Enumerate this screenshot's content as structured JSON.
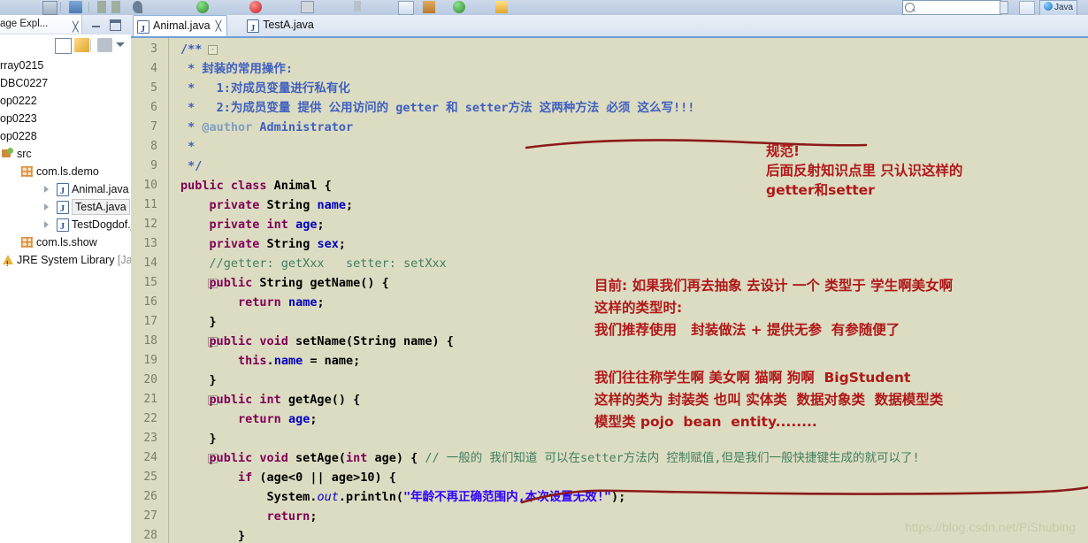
{
  "toolbar": {
    "search_placeholder": "",
    "perspective_label": "Java",
    "icons": [
      "save-icon",
      "print-icon",
      "undo-icon",
      "redo-icon",
      "debug-icon",
      "run-icon",
      "coverage-icon",
      "external-tools-icon",
      "new-icon",
      "search-icon",
      "next-annotation-icon",
      "open-type-icon",
      "java-perspective-icon"
    ]
  },
  "explorer": {
    "title": "age Expl...",
    "close_glyph": "╳",
    "toolbar_icons": [
      "collapse-all-icon",
      "link-with-editor-icon",
      "focus-icon",
      "view-menu-icon"
    ],
    "tree": [
      {
        "label": "rray0215",
        "indent": 0,
        "icon": "none",
        "arrow": false,
        "selected": false,
        "dim": false
      },
      {
        "label": "DBC0227",
        "indent": 0,
        "icon": "none",
        "arrow": false,
        "selected": false,
        "dim": false
      },
      {
        "label": "op0222",
        "indent": 0,
        "icon": "none",
        "arrow": false,
        "selected": false,
        "dim": false
      },
      {
        "label": "op0223",
        "indent": 0,
        "icon": "none",
        "arrow": false,
        "selected": false,
        "dim": false
      },
      {
        "label": "op0228",
        "indent": 0,
        "icon": "none",
        "arrow": false,
        "selected": false,
        "dim": false
      },
      {
        "label": "src",
        "indent": 0,
        "icon": "source-folder-icon",
        "arrow": false,
        "selected": false,
        "dim": false
      },
      {
        "label": "com.ls.demo",
        "indent": 1,
        "icon": "package-icon",
        "arrow": false,
        "selected": false,
        "dim": false
      },
      {
        "label": "Animal.java",
        "indent": 2,
        "icon": "java-file-icon",
        "arrow": true,
        "selected": false,
        "dim": false
      },
      {
        "label": "TestA.java",
        "indent": 2,
        "icon": "java-file-icon",
        "arrow": true,
        "selected": true,
        "dim": false
      },
      {
        "label": "TestDogdof.java",
        "indent": 2,
        "icon": "java-file-icon",
        "arrow": true,
        "selected": false,
        "dim": false
      },
      {
        "label": "com.ls.show",
        "indent": 1,
        "icon": "package-icon",
        "arrow": false,
        "selected": false,
        "dim": false
      },
      {
        "label": "JRE System Library",
        "suffix": "[Ja",
        "indent": 0,
        "icon": "jre-library-icon",
        "arrow": false,
        "selected": false,
        "dim": false
      }
    ]
  },
  "editor": {
    "tabs": [
      {
        "label": "Animal.java",
        "active": true,
        "close_glyph": "╳"
      },
      {
        "label": "TestA.java",
        "active": false,
        "close_glyph": ""
      }
    ],
    "first_visible_line": 3,
    "lines": [
      {
        "n": 3,
        "fold": "-",
        "html": "<span class=\"cmj\">/**</span>"
      },
      {
        "n": 4,
        "fold": "",
        "html": "<span class=\"cmj\"> * 封装的常用操作:</span>"
      },
      {
        "n": 5,
        "fold": "",
        "html": "<span class=\"cmj\"> *   1:对成员变量进行私有化</span>"
      },
      {
        "n": 6,
        "fold": "",
        "html": "<span class=\"cmj\"> *   2:为成员变量 提供 公用访问的 getter 和 setter方法 这两种方法 必须 这么写!!!</span>"
      },
      {
        "n": 7,
        "fold": "",
        "html": "<span class=\"cmj\"> * </span><span class=\"cmtag\">@author</span><span class=\"cmj\"> Administrator</span>"
      },
      {
        "n": 8,
        "fold": "",
        "html": "<span class=\"cmj\"> *</span>"
      },
      {
        "n": 9,
        "fold": "",
        "html": "<span class=\"cmj\"> */</span>"
      },
      {
        "n": 10,
        "fold": "",
        "html": "<span class=\"kw\">public class</span><span class=\"pln\"> Animal {</span>"
      },
      {
        "n": 11,
        "fold": "",
        "html": "<span class=\"pln\">    </span><span class=\"kw\">private</span><span class=\"pln\"> String </span><span class=\"fld\">name</span><span class=\"pln\">;</span>"
      },
      {
        "n": 12,
        "fold": "",
        "html": "<span class=\"pln\">    </span><span class=\"kw\">private int</span><span class=\"pln\"> </span><span class=\"fld\">age</span><span class=\"pln\">;</span>"
      },
      {
        "n": 13,
        "fold": "",
        "html": "<span class=\"pln\">    </span><span class=\"kw\">private</span><span class=\"pln\"> String </span><span class=\"fld\">sex</span><span class=\"pln\">;</span>"
      },
      {
        "n": 14,
        "fold": "",
        "html": "<span class=\"pln\">    </span><span class=\"cm\">//getter: getXxx   setter: setXxx</span>"
      },
      {
        "n": 15,
        "fold": "-",
        "html": "<span class=\"pln\">    </span><span class=\"kw\">public</span><span class=\"pln\"> String getName() {</span>"
      },
      {
        "n": 16,
        "fold": "",
        "html": "<span class=\"pln\">        </span><span class=\"kw\">return</span><span class=\"pln\"> </span><span class=\"fld\">name</span><span class=\"pln\">;</span>"
      },
      {
        "n": 17,
        "fold": "",
        "html": "<span class=\"pln\">    }</span>"
      },
      {
        "n": 18,
        "fold": "-",
        "html": "<span class=\"pln\">    </span><span class=\"kw\">public void</span><span class=\"pln\"> setName(String name) {</span>"
      },
      {
        "n": 19,
        "fold": "",
        "html": "<span class=\"pln\">        </span><span class=\"kw\">this</span><span class=\"pln\">.</span><span class=\"fld\">name</span><span class=\"pln\"> = name;</span>"
      },
      {
        "n": 20,
        "fold": "",
        "html": "<span class=\"pln\">    }</span>"
      },
      {
        "n": 21,
        "fold": "-",
        "html": "<span class=\"pln\">    </span><span class=\"kw\">public int</span><span class=\"pln\"> getAge() {</span>"
      },
      {
        "n": 22,
        "fold": "",
        "html": "<span class=\"pln\">        </span><span class=\"kw\">return</span><span class=\"pln\"> </span><span class=\"fld\">age</span><span class=\"pln\">;</span>"
      },
      {
        "n": 23,
        "fold": "",
        "html": "<span class=\"pln\">    }</span>"
      },
      {
        "n": 24,
        "fold": "-",
        "html": "<span class=\"pln\">    </span><span class=\"kw\">public void</span><span class=\"pln\"> setAge(</span><span class=\"kw\">int</span><span class=\"pln\"> age) { </span><span class=\"cm\">// 一般的 我们知道 可以在setter方法内 控制赋值,但是我们一般快捷键生成的就可以了!</span>"
      },
      {
        "n": 25,
        "fold": "",
        "html": "<span class=\"pln\">        </span><span class=\"kw\">if</span><span class=\"pln\"> (age&lt;0 || age&gt;10) {</span>"
      },
      {
        "n": 26,
        "fold": "",
        "html": "<span class=\"pln\">            System.</span><span class=\"itl\">out</span><span class=\"pln\">.println(</span><span class=\"str\">\"年龄不再正确范围内,本次设置无效!\"</span><span class=\"pln\">);</span>"
      },
      {
        "n": 27,
        "fold": "",
        "html": "<span class=\"pln\">            </span><span class=\"kw\">return</span><span class=\"pln\">;</span>"
      },
      {
        "n": 28,
        "fold": "",
        "html": "<span class=\"pln\">        }</span>"
      }
    ]
  },
  "annotations": [
    {
      "name": "annotation-standard",
      "lines": [
        "规范!",
        "后面反射知识点里 只认识这样的",
        "getter和setter"
      ],
      "color": "#b01818"
    },
    {
      "name": "annotation-abstraction",
      "lines": [
        "目前: 如果我们再去抽象 去设计 一个 类型于 学生啊美女啊",
        "这样的类型时:",
        "我们推荐使用   封装做法 + 提供无参  有参随便了"
      ],
      "color": "#b01818"
    },
    {
      "name": "annotation-pojo",
      "lines": [
        "我们往往称学生啊 美女啊 猫啊 狗啊  BigStudent",
        "这样的类为 封装类 也叫 实体类  数据对象类  数据模型类",
        "模型类 pojo  bean  entity........"
      ],
      "color": "#b01818"
    }
  ],
  "underlines": [
    {
      "name": "underline-getter-setter",
      "color": "#8b1a1a"
    },
    {
      "name": "underline-setage-comment",
      "color": "#8b1a1a"
    }
  ],
  "watermark": "https://blog.csdn.net/PiShubing",
  "colors": {
    "editor_background": "#dcdcc2",
    "annotation_red": "#b01818",
    "underline_red": "#8b1a1a",
    "keyword_purple": "#7f0055",
    "comment_green": "#3f7f5f",
    "javadoc_blue": "#3f5fbf",
    "string_blue": "#2a00ff",
    "field_blue": "#0000c0",
    "watermark_gray": "#c9c9ab"
  }
}
